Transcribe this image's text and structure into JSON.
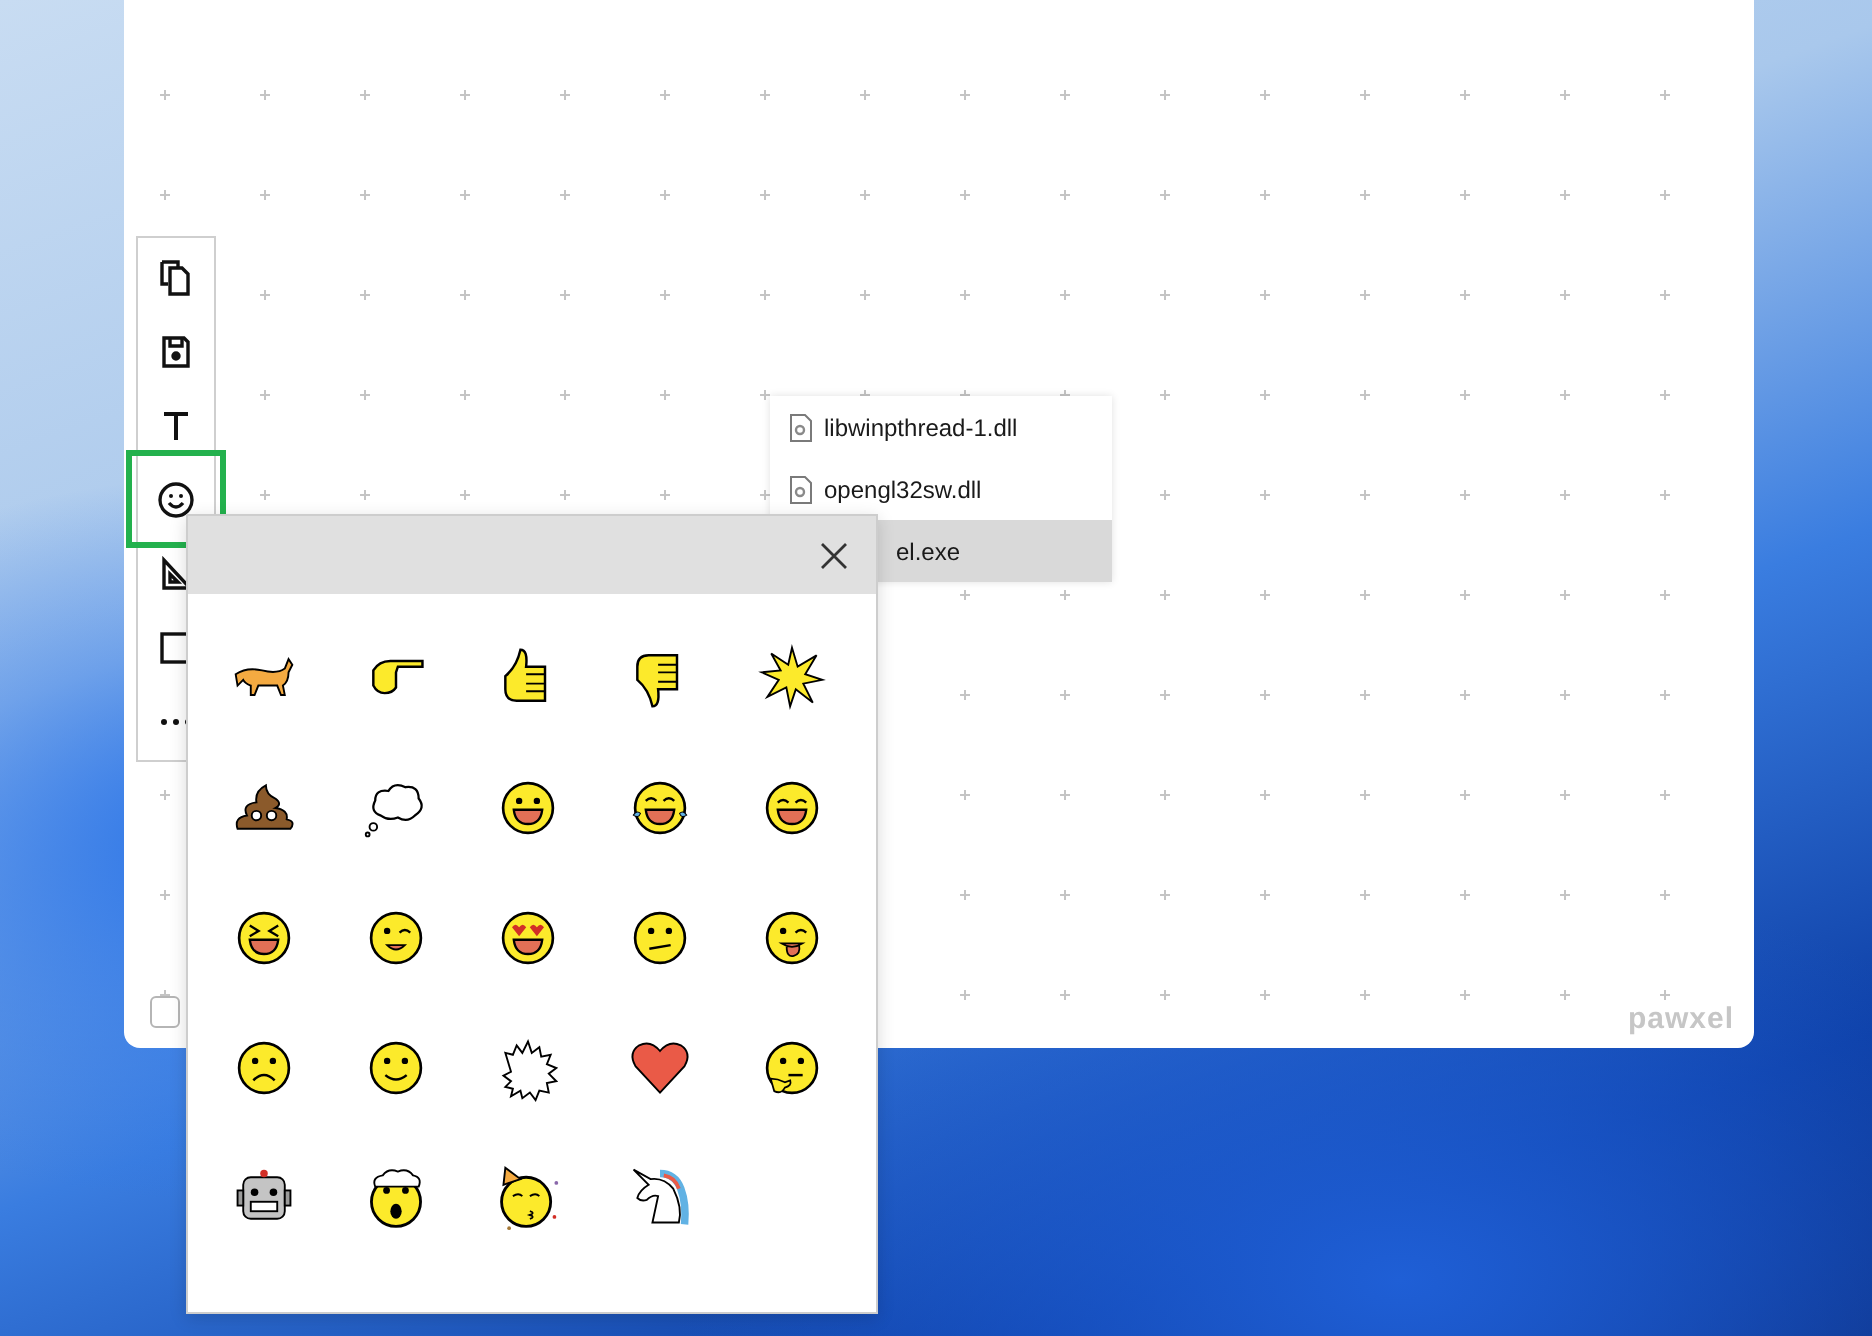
{
  "toolbar": {
    "tools": [
      {
        "kind": "copy",
        "selected": false
      },
      {
        "kind": "save",
        "selected": false
      },
      {
        "kind": "text",
        "selected": false
      },
      {
        "kind": "emoji",
        "selected": true
      },
      {
        "kind": "ruler",
        "selected": false
      },
      {
        "kind": "rectangle",
        "selected": false
      },
      {
        "kind": "more",
        "selected": false
      }
    ]
  },
  "file_list": {
    "items": [
      {
        "name": "libwinpthread-1.dll",
        "kind": "file",
        "selected": false
      },
      {
        "name": "opengl32sw.dll",
        "kind": "file",
        "selected": false
      },
      {
        "name": "el.exe",
        "kind": "covered",
        "selected": true
      }
    ]
  },
  "emoji_picker": {
    "emojis": [
      {
        "kind": "cat"
      },
      {
        "kind": "pointing-hand"
      },
      {
        "kind": "thumbs-up"
      },
      {
        "kind": "thumbs-down"
      },
      {
        "kind": "burst"
      },
      {
        "kind": "poo"
      },
      {
        "kind": "thought-bubble"
      },
      {
        "kind": "grin"
      },
      {
        "kind": "joy"
      },
      {
        "kind": "beaming"
      },
      {
        "kind": "squint"
      },
      {
        "kind": "wink"
      },
      {
        "kind": "heart-eyes"
      },
      {
        "kind": "confused"
      },
      {
        "kind": "tongue-wink"
      },
      {
        "kind": "frown"
      },
      {
        "kind": "slight-smile"
      },
      {
        "kind": "anger-bubble"
      },
      {
        "kind": "heart"
      },
      {
        "kind": "thinking"
      },
      {
        "kind": "robot"
      },
      {
        "kind": "exploding-head"
      },
      {
        "kind": "party"
      },
      {
        "kind": "unicorn"
      }
    ]
  },
  "logo": "pawxel"
}
